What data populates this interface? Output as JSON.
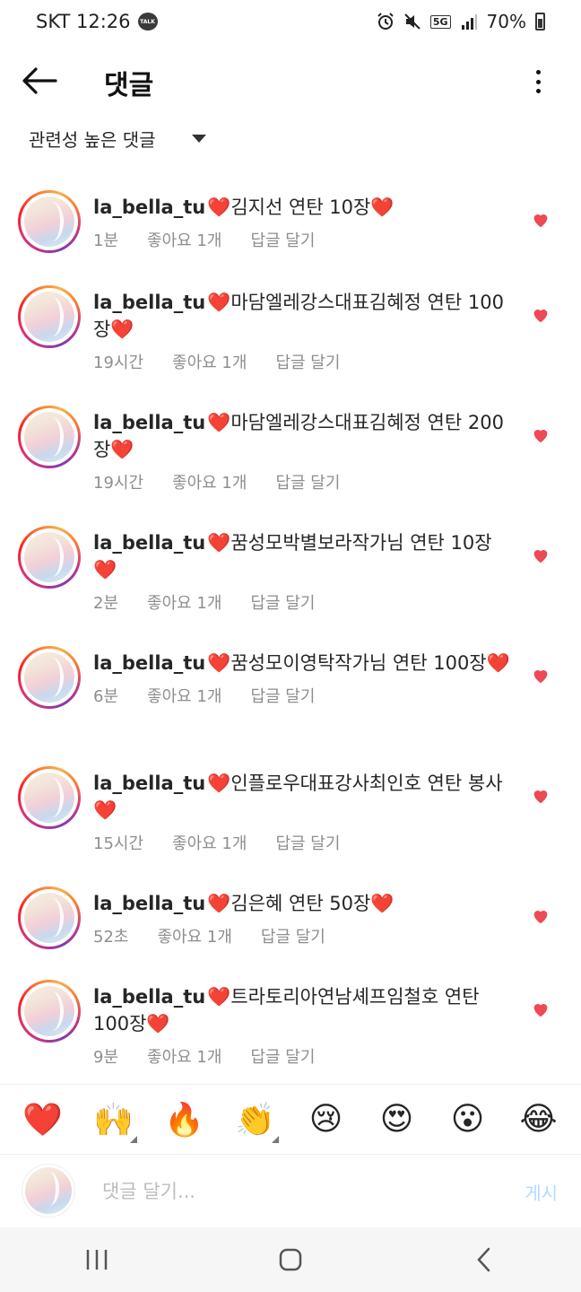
{
  "status_bar": {
    "carrier_time": "SKT 12:26",
    "talk_badge": "TALK",
    "network": "5G",
    "battery": "70%"
  },
  "header": {
    "title": "댓글"
  },
  "sort": {
    "label": "관련성 높은 댓글"
  },
  "comments": [
    {
      "username": "la_bella_tu",
      "text": "김지선 연탄 10장",
      "time": "1분",
      "likes": "좋아요 1개",
      "reply": "답글 달기"
    },
    {
      "username": "la_bella_tu",
      "text": "마담엘레강스대표김혜정 연탄 100장",
      "time": "19시간",
      "likes": "좋아요 1개",
      "reply": "답글 달기"
    },
    {
      "username": "la_bella_tu",
      "text": "마담엘레강스대표김혜정 연탄 200장",
      "time": "19시간",
      "likes": "좋아요 1개",
      "reply": "답글 달기"
    },
    {
      "username": "la_bella_tu",
      "text": "꿈성모박별보라작가님 연탄 10장",
      "time": "2분",
      "likes": "좋아요 1개",
      "reply": "답글 달기"
    },
    {
      "username": "la_bella_tu",
      "text": "꿈성모이영탁작가님 연탄 100장",
      "time": "6분",
      "likes": "좋아요 1개",
      "reply": "답글 달기"
    },
    {
      "username": "la_bella_tu",
      "text": "인플로우대표강사최인호 연탄 봉사",
      "time": "15시간",
      "likes": "좋아요 1개",
      "reply": "답글 달기"
    },
    {
      "username": "la_bella_tu",
      "text": "김은혜 연탄 50장",
      "time": "52초",
      "likes": "좋아요 1개",
      "reply": "답글 달기"
    },
    {
      "username": "la_bella_tu",
      "text": "트라토리아연남셰프임철호 연탄 100장",
      "time": "9분",
      "likes": "좋아요 1개",
      "reply": "답글 달기"
    }
  ],
  "emoji_bar": [
    "❤️",
    "🙌",
    "🔥",
    "👏",
    "😢",
    "😍",
    "😮",
    "😂"
  ],
  "input": {
    "placeholder": "댓글 달기...",
    "post_label": "게시"
  },
  "colors": {
    "like_heart": "#ed4956",
    "post_disabled": "#b3dbff",
    "meta_text": "#8e8e8e"
  }
}
